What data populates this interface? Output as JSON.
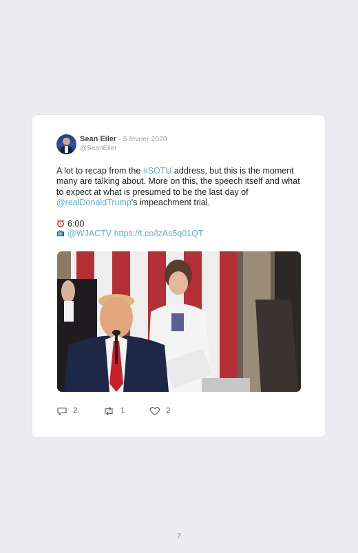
{
  "tweet": {
    "author_name": "Sean Eiler",
    "date": "5 février 2020",
    "handle": "@SeanEiler",
    "text_1": "A lot to recap from the ",
    "hashtag": "#SOTU",
    "text_2": " address, but this is the moment many are talking about. More on this, the speech itself and what to expect at what is presumed to be the last day of ",
    "mention": "@realDonaldTrump",
    "text_3": "'s impeachment trial.",
    "time_line": "6:00",
    "channel_mention": "@WJACTV",
    "short_link": "https://t.co/lzAs5q01QT",
    "replies": "2",
    "retweets": "1",
    "likes": "2"
  },
  "icons": [
    "alarm-clock-icon",
    "television-icon",
    "reply-icon",
    "retweet-icon",
    "heart-icon"
  ],
  "colors": {
    "link": "#5aaee0",
    "page_bg": "#ebebf0",
    "card_bg": "#ffffff"
  },
  "page_number": "7"
}
